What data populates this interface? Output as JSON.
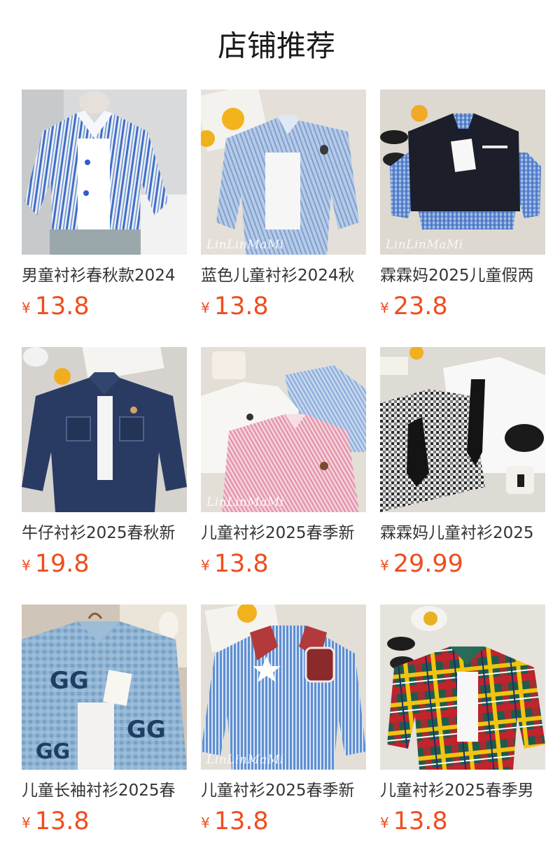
{
  "page": {
    "title": "店铺推荐"
  },
  "watermark_text": "LinLinMaMi",
  "currency": "¥",
  "colors": {
    "price": "#ef4d1f",
    "text": "#333333",
    "title": "#1a1a1a"
  },
  "products": [
    {
      "name": "男童衬衫春秋款2024",
      "price": "13.8",
      "watermark": false
    },
    {
      "name": "蓝色儿童衬衫2024秋",
      "price": "13.8",
      "watermark": true
    },
    {
      "name": "霖霖妈2025儿童假两",
      "price": "23.8",
      "watermark": true
    },
    {
      "name": "牛仔衬衫2025春秋新",
      "price": "19.8",
      "watermark": false
    },
    {
      "name": "儿童衬衫2025春季新",
      "price": "13.8",
      "watermark": true
    },
    {
      "name": "霖霖妈儿童衬衫2025",
      "price": "29.99",
      "watermark": false
    },
    {
      "name": "儿童长袖衬衫2025春",
      "price": "13.8",
      "watermark": false
    },
    {
      "name": "儿童衬衫2025春季新",
      "price": "13.8",
      "watermark": true
    },
    {
      "name": "儿童衬衫2025春季男",
      "price": "13.8",
      "watermark": false
    }
  ]
}
